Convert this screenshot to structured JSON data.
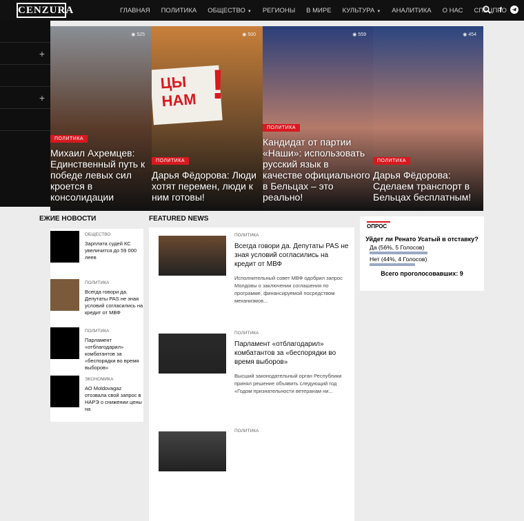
{
  "header": {
    "logo": "CENZURA",
    "nav": [
      {
        "label": "ГЛАВНАЯ",
        "caret": false
      },
      {
        "label": "ПОЛИТИКА",
        "caret": false
      },
      {
        "label": "ОБЩЕСТВО",
        "caret": true
      },
      {
        "label": "РЕГИОНЫ",
        "caret": false
      },
      {
        "label": "В МИРЕ",
        "caret": false
      },
      {
        "label": "КУЛЬТУРА",
        "caret": true
      },
      {
        "label": "АНАЛИТИКА",
        "caret": false
      },
      {
        "label": "О НАС",
        "caret": false
      },
      {
        "label": "СПЕЦПРО",
        "caret": false
      }
    ],
    "icons": [
      "search-icon",
      "facebook-icon",
      "telegram-icon"
    ]
  },
  "hero": [
    {
      "views": "525",
      "category": "ПОЛИТИКА",
      "title": "Михаил Ахремцев: Единственный путь к победе левых сил кроется в консолидации",
      "colors": [
        "#8a8f96",
        "#5a3b2a"
      ]
    },
    {
      "views": "500",
      "category": "ПОЛИТИКА",
      "title": "Дарья Фёдорова: Люди хотят перемен, люди к ним готовы!",
      "colors": [
        "#c9803a",
        "#6b4a2b"
      ],
      "poster_a": "ЦЫ",
      "poster_b": "НАМ",
      "poster_c": "!"
    },
    {
      "views": "559",
      "category": "ПОЛИТИКА",
      "title": "Кандидат от партии «Наши»: использовать русский язык в качестве официального в Бельцах – это реально!",
      "colors": [
        "#2a3f7a",
        "#b47a6a"
      ]
    },
    {
      "views": "454",
      "category": "ПОЛИТИКА",
      "title": "Дарья Фёдорова: Сделаем транспорт в Бельцах бесплатным!",
      "colors": [
        "#2b4580",
        "#b87c6b"
      ]
    }
  ],
  "latest": {
    "heading": "ЕЖИЕ НОВОСТИ",
    "items": [
      {
        "category": "ОБЩЕСТВО",
        "title": "Зарплата судей КС увеличится до 59 000 леев",
        "thumb": "#000000"
      },
      {
        "category": "ПОЛИТИКА",
        "title": "Всегда говори да. Депутаты PAS не зная условий согласились на кредит от МВФ",
        "thumb": "#7a5a3a"
      },
      {
        "category": "ПОЛИТИКА",
        "title": "Парламент «отблагодарил» комбатантов за «беспорядки во время выборов»",
        "thumb": "#000000"
      },
      {
        "category": "ЭКОНОМИКА",
        "title": "АО Moldovagaz отозвала свой запрос в НАРЭ о снижении цены на",
        "thumb": "#000000"
      }
    ]
  },
  "featured": {
    "heading": "FEATURED NEWS",
    "items": [
      {
        "category": "ПОЛИТИКА",
        "title": "Всегда говори да. Депутаты PAS не зная условий согласились на кредит от МВФ",
        "desc": "Исполнительный совет МВФ одобрил запрос Молдовы о заключении соглашения по программе, финансируемой посредством механизмов...",
        "thumb": "#6b4a30"
      },
      {
        "category": "ПОЛИТИКА",
        "title": "Парламент «отблагодарил» комбатантов за «беспорядки во время выборов»",
        "desc": "Высший законодательный орган Республики принял решение объявить следующий год «Годом признательности ветеранам ни...",
        "thumb": "#2a2a2a"
      },
      {
        "category": "ПОЛИТИКА",
        "title": "",
        "desc": "",
        "thumb": "#444444"
      }
    ]
  },
  "poll": {
    "heading": "ОПРОС",
    "question": "Уйдет ли Ренато Усатый в отставку?",
    "options": [
      {
        "label": "Да (56%, 5 Голосов)",
        "fraction": 0.56
      },
      {
        "label": "Нет (44%, 4 Голосов)",
        "fraction": 0.44
      }
    ],
    "total": "Всего проголосовавших: 9"
  }
}
